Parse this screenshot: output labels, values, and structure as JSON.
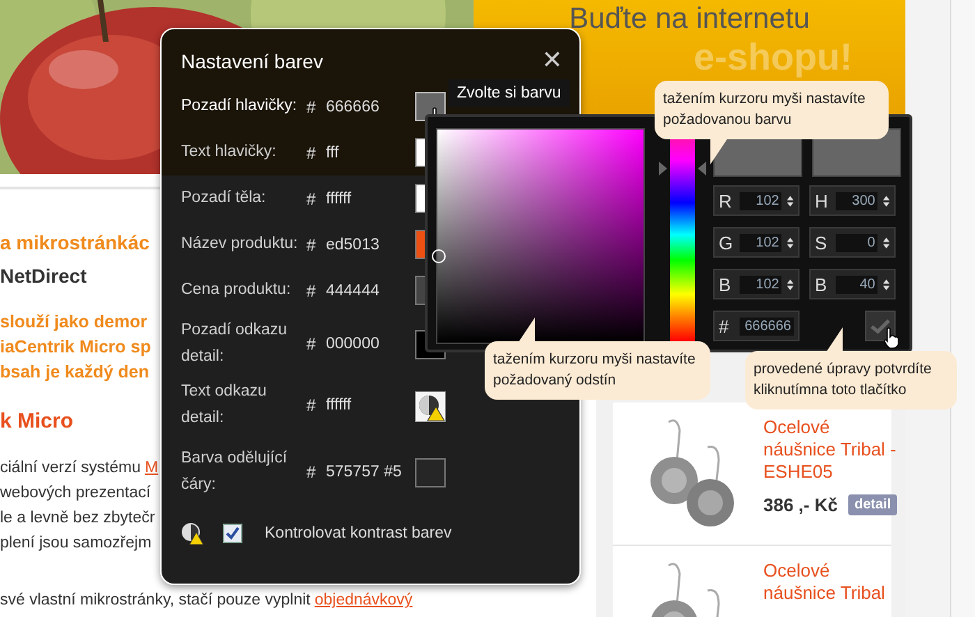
{
  "banner": {
    "headline": "Buďte na internetu",
    "subline": "e-shopu!"
  },
  "article": {
    "heading": "a mikrostránkác",
    "company": "NetDirect",
    "intro": [
      "slouží jako demor",
      "iaCentrik Micro sp",
      "bsah je každý den"
    ],
    "subheading": "k Micro",
    "paragraph": [
      {
        "text": "ciální verzí systému",
        "link": "M"
      },
      {
        "text": "webových prezentací"
      },
      {
        "text": "le a levně bez zbytečr"
      },
      {
        "text": "plení jsou samozřejm"
      }
    ],
    "footer": {
      "text": "své vlastní mikrostránky, stačí pouze vyplnit",
      "link": "objednávkový"
    }
  },
  "products": [
    {
      "name": "Ocelové náušnice Tribal - ESHE05",
      "price": "386 ,- Kč",
      "button": "detail"
    },
    {
      "name": "Ocelové náušnice Tribal"
    }
  ],
  "dialog": {
    "title": "Nastavení barev",
    "close": "✕",
    "rows": [
      {
        "label": "Pozadí hlavičky:",
        "hash": "#",
        "value": "666666",
        "kind": "swatch",
        "color": "#666666",
        "selected": true
      },
      {
        "label": "Text hlavičky:",
        "hash": "#",
        "value": "fff",
        "kind": "swatch",
        "color": "#ffffff",
        "selected": false
      },
      {
        "label": "Pozadí těla:",
        "hash": "#",
        "value": "ffffff",
        "kind": "swatch",
        "color": "#ffffff",
        "selected": false
      },
      {
        "label": "Název produktu:",
        "hash": "#",
        "value": "ed5013",
        "kind": "swatch",
        "color": "#ed5013",
        "selected": false
      },
      {
        "label": "Cena produktu:",
        "hash": "#",
        "value": "444444",
        "kind": "swatch",
        "color": "#444444",
        "selected": false
      },
      {
        "label": "Pozadí odkazu detail:",
        "hash": "#",
        "value": "000000",
        "kind": "swatch",
        "color": "#000000",
        "selected": false
      },
      {
        "label": "Text odkazu detail:",
        "hash": "#",
        "value": "ffffff",
        "kind": "warning",
        "selected": false
      },
      {
        "label": "Barva odělující čáry:",
        "hash": "#",
        "value": "575757 #5",
        "kind": "swatch",
        "color": "#262626",
        "selected": false
      }
    ],
    "check": {
      "label": "Kontrolovat kontrast barev",
      "checked": true
    }
  },
  "tooltip": "Zvolte si barvu",
  "picker": {
    "hue": {
      "level": 0.83
    },
    "fields": [
      {
        "label": "R",
        "value": "102"
      },
      {
        "label": "H",
        "value": "300"
      },
      {
        "label": "G",
        "value": "102"
      },
      {
        "label": "S",
        "value": "0"
      },
      {
        "label": "B",
        "value": "102"
      },
      {
        "label": "B",
        "value": "40"
      }
    ],
    "hex": {
      "label": "#",
      "value": "666666"
    }
  },
  "callouts": [
    "tažením kurzoru myši nastavíte požadovanou barvu",
    "tažením kurzoru myši nastavíte požadovaný odstín",
    "provedené úpravy potvrdíte kliknutímna toto tlačítko"
  ]
}
